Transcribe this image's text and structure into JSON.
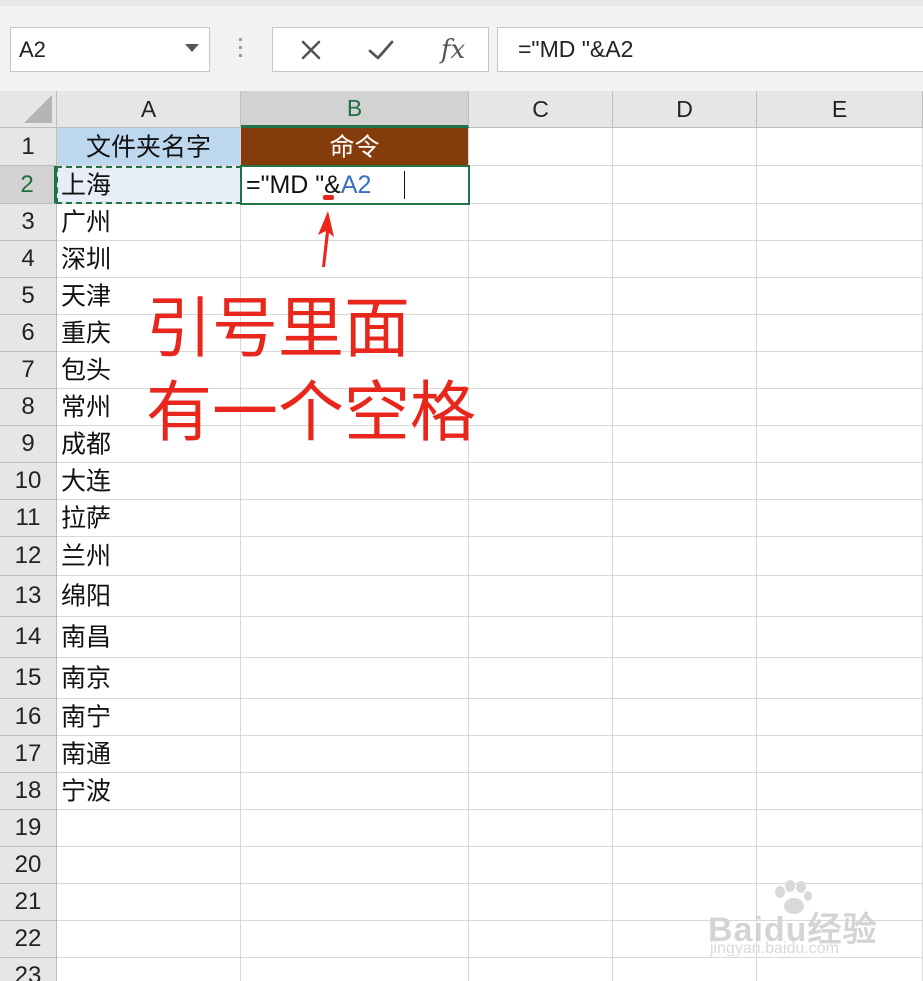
{
  "formula_bar": {
    "name_box": "A2",
    "cancel_icon": "close-icon",
    "enter_icon": "check-icon",
    "fx_label": "fx",
    "formula": "=\"MD \"&A2"
  },
  "columns": [
    "A",
    "B",
    "C",
    "D",
    "E"
  ],
  "rows": [
    "1",
    "2",
    "3",
    "4",
    "5",
    "6",
    "7",
    "8",
    "9",
    "10",
    "11",
    "12",
    "13",
    "14",
    "15",
    "16",
    "17",
    "18",
    "19",
    "20",
    "21",
    "22",
    "23"
  ],
  "cells": {
    "A1": "文件夹名字",
    "B1": "命令",
    "A": [
      "上海",
      "广州",
      "深圳",
      "天津",
      "重庆",
      "包头",
      "常州",
      "成都",
      "大连",
      "拉萨",
      "兰州",
      "绵阳",
      "南昌",
      "南京",
      "南宁",
      "南通",
      "宁波"
    ]
  },
  "editing": {
    "cell": "B2",
    "text_part": "=\"MD \"&",
    "ref_part": "A2"
  },
  "annotation": {
    "line1": "引号里面",
    "line2": "有一个空格"
  },
  "watermark": {
    "main": "Baidu经验",
    "sub": "jingyan.baidu.com"
  },
  "colors": {
    "header_a_fill": "#bdd7ee",
    "header_b_fill": "#843c0c",
    "annotation": "#e8261b",
    "selection": "#217346",
    "reference": "#3a6fc4"
  }
}
